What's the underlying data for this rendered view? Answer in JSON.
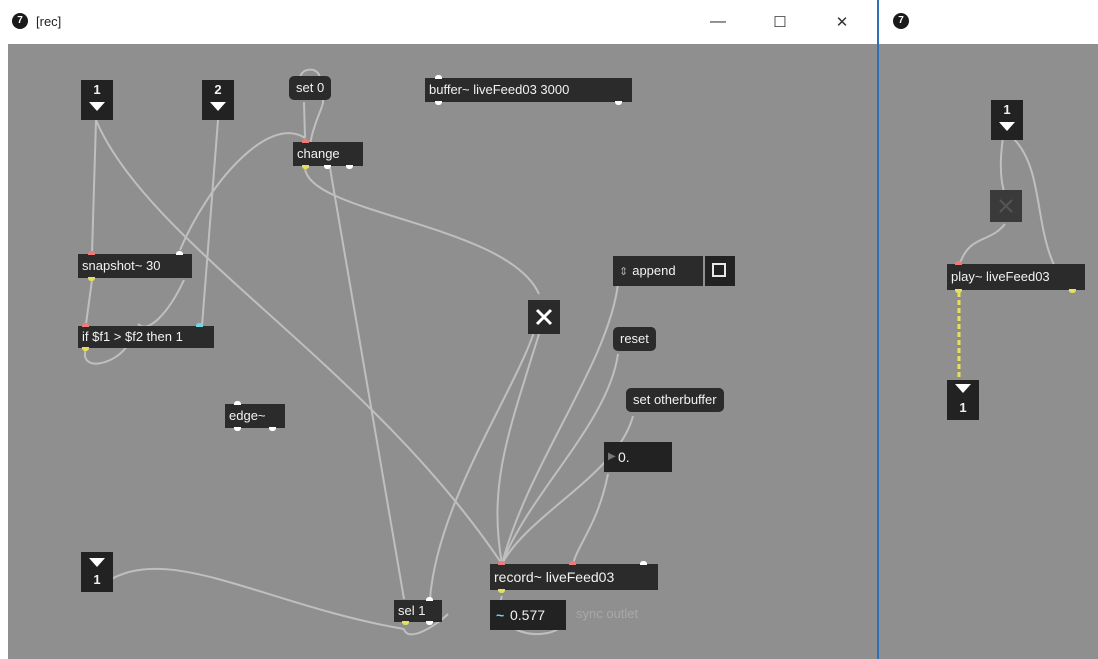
{
  "left_window": {
    "title": "[rec]",
    "minimize_glyph": "—",
    "maximize_glyph": "☐",
    "close_glyph": "✕"
  },
  "right_window": {
    "title": ""
  },
  "objects": {
    "set0": "set 0",
    "buffer": "buffer~ liveFeed03 3000",
    "change": "change",
    "snapshot": "snapshot~ 30",
    "ifthen": "if $f1 > $f2 then 1",
    "append": "append",
    "reset": "reset",
    "set_otherbuffer": "set otherbuffer",
    "edge": "edge~",
    "record": "record~ liveFeed03",
    "sel1": "sel 1",
    "sync_value": "0.577",
    "sync_comment": "sync outlet",
    "float_value": "0.",
    "play": "play~ liveFeed03"
  },
  "number_boxes": {
    "top_left": "1",
    "top_mid": "2",
    "bottom_left": "1",
    "right_top": "1",
    "right_bottom": "1"
  },
  "icons": {
    "app": "max-logo-icon",
    "toggle_on": "x-toggle-icon",
    "number_arrow_down": "triangle-down-icon",
    "number_arrow_up": "triangle-up-icon"
  },
  "colors": {
    "canvas": "#8f8f8f",
    "object": "#2b2b2b",
    "inlet": "#f07a7a",
    "outlet_signal": "#e8e05a",
    "cable": "#c8c8c8",
    "signal_cable": "#e8e05a",
    "accent_divider": "#2f6fb5"
  }
}
